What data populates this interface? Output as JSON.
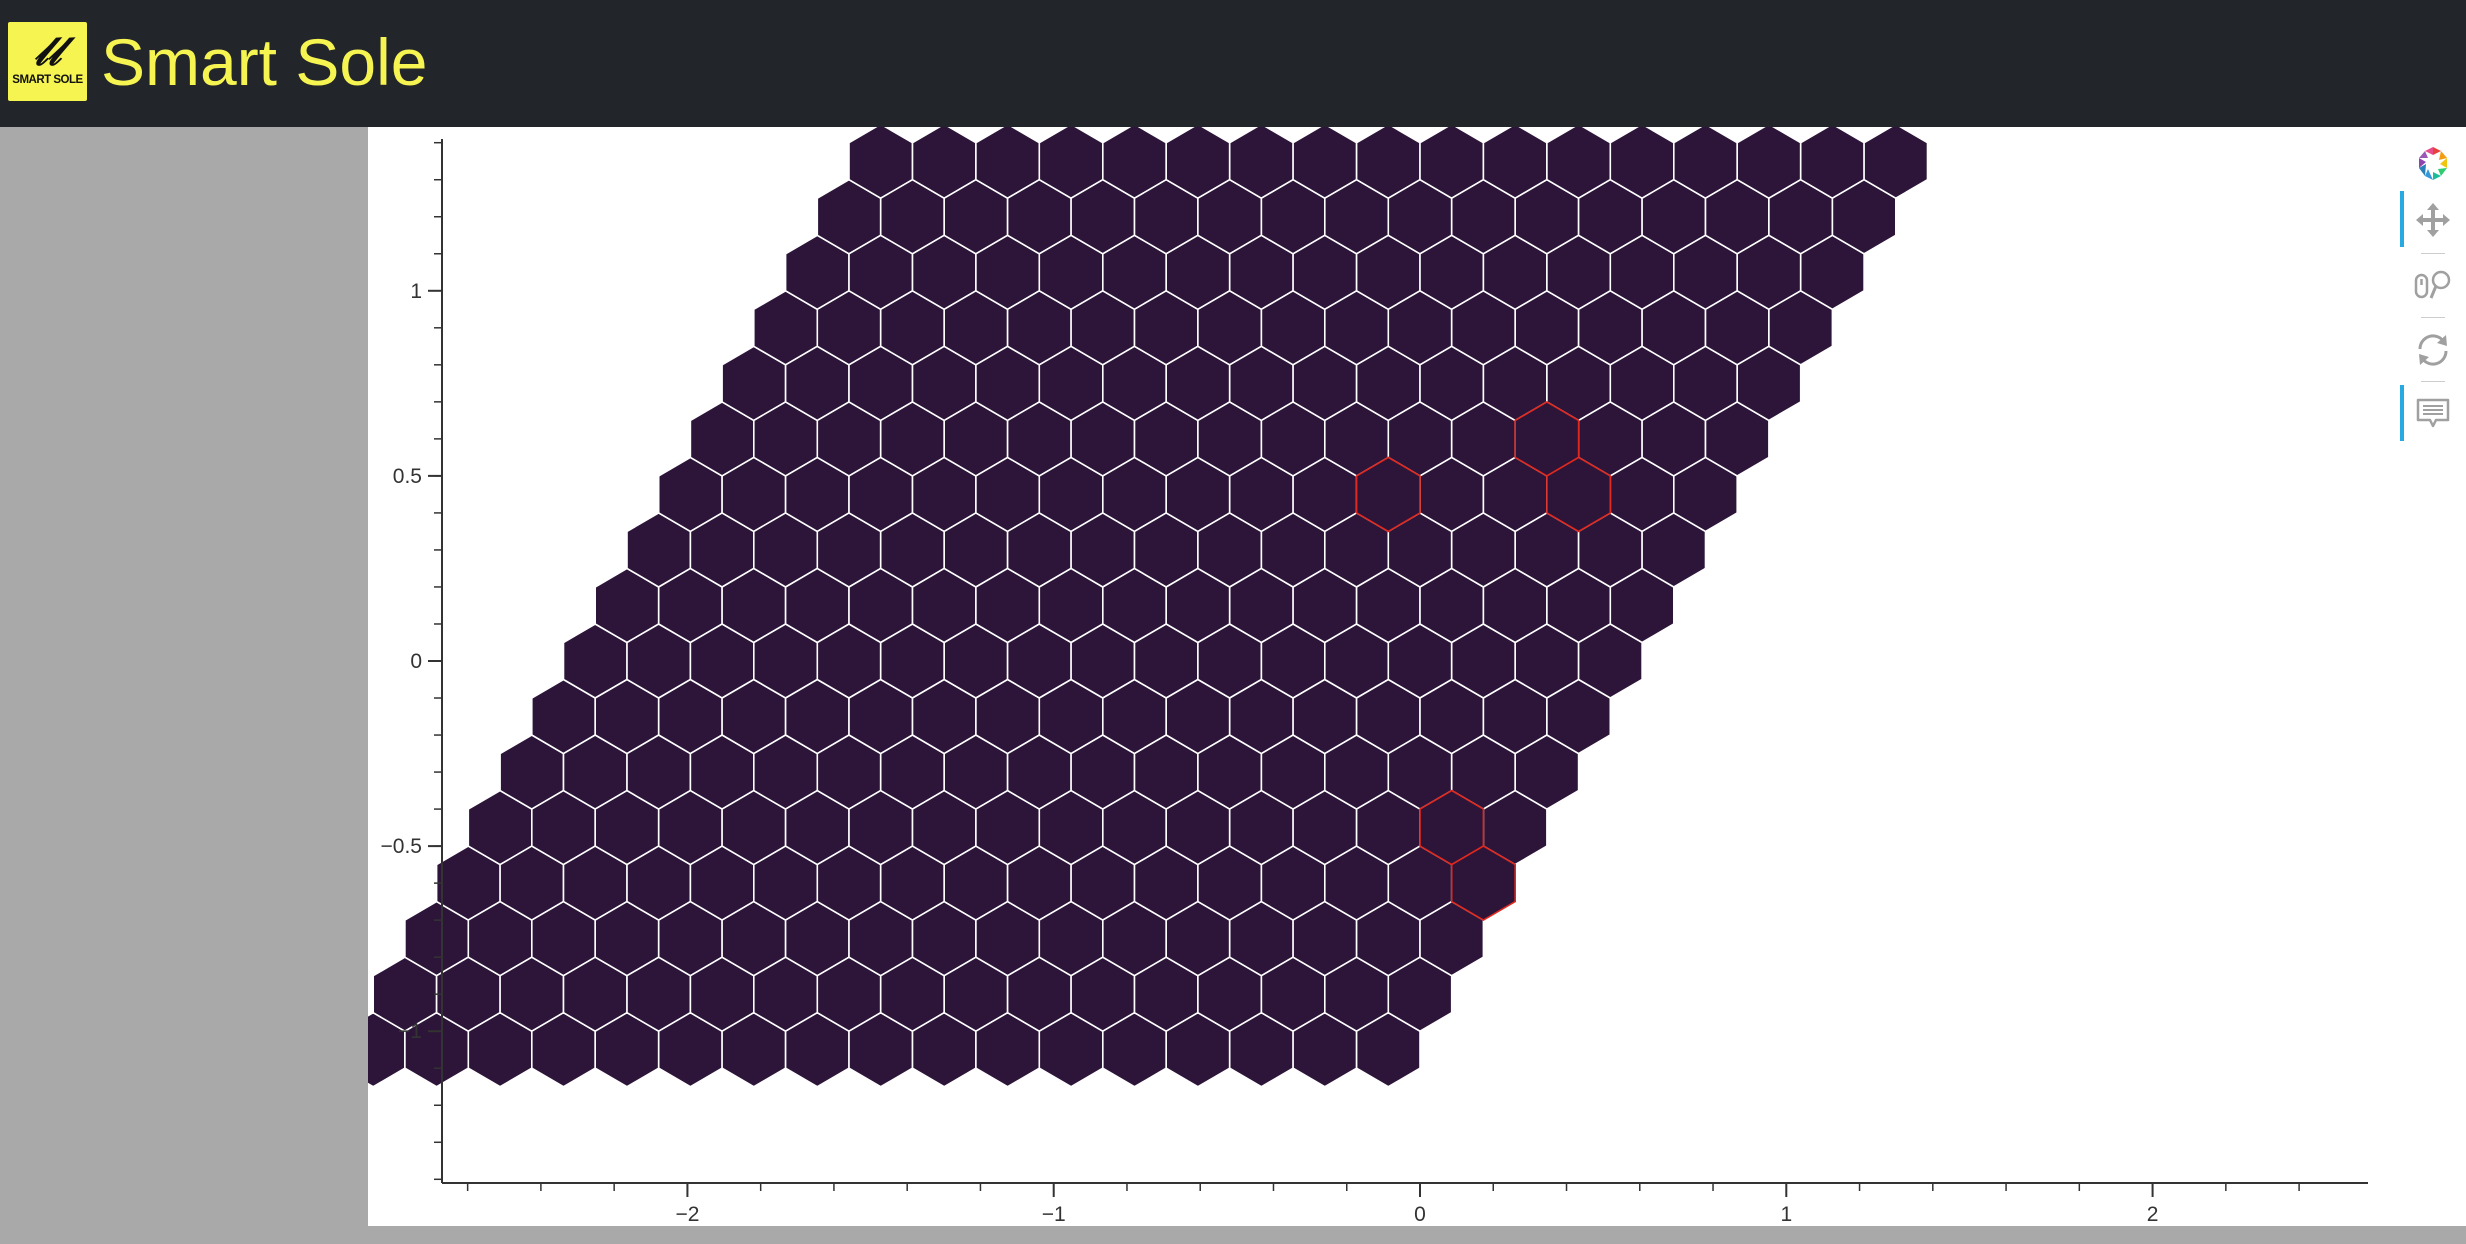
{
  "header": {
    "title": "Smart Sole",
    "logo": {
      "text": "SMART SOLE",
      "glyph": "𝓁𝓁",
      "background": "#f6f451"
    }
  },
  "toolbar": {
    "tools": [
      {
        "name": "bokeh-logo-icon",
        "active": false
      },
      {
        "name": "pan-icon",
        "active": true
      },
      {
        "name": "wheel-zoom-icon",
        "active": false
      },
      {
        "name": "reset-icon",
        "active": false
      },
      {
        "name": "hover-icon",
        "active": true
      }
    ]
  },
  "chart_data": {
    "type": "heatmap",
    "subtype": "hex-tile",
    "orientation": "pointytop",
    "hex_size": 0.1,
    "q_range": [
      -13,
      3
    ],
    "r_range": [
      -7,
      9
    ],
    "fill_color": "#2c1539",
    "line_color": "#ffffff",
    "highlight_line_color": "#e0281e",
    "highlighted": [
      {
        "q": 0,
        "r": 4
      },
      {
        "q": -2,
        "r": 3
      },
      {
        "q": 1,
        "r": 3
      },
      {
        "q": 2,
        "r": -3
      },
      {
        "q": 3,
        "r": -4
      }
    ],
    "xlim": [
      -2.67,
      2.67
    ],
    "ylim": [
      -1.41,
      1.41
    ],
    "x_ticks": [
      {
        "value": -2,
        "label": "−2"
      },
      {
        "value": -1,
        "label": "−1"
      },
      {
        "value": 0,
        "label": "0"
      },
      {
        "value": 1,
        "label": "1"
      },
      {
        "value": 2,
        "label": "2"
      }
    ],
    "y_ticks": [
      {
        "value": 1,
        "label": "1"
      },
      {
        "value": 0.5,
        "label": "0.5"
      },
      {
        "value": 0,
        "label": "0"
      },
      {
        "value": -0.5,
        "label": "−0.5"
      },
      {
        "value": -1,
        "label": "−1"
      }
    ],
    "title": "",
    "xlabel": "",
    "ylabel": ""
  }
}
